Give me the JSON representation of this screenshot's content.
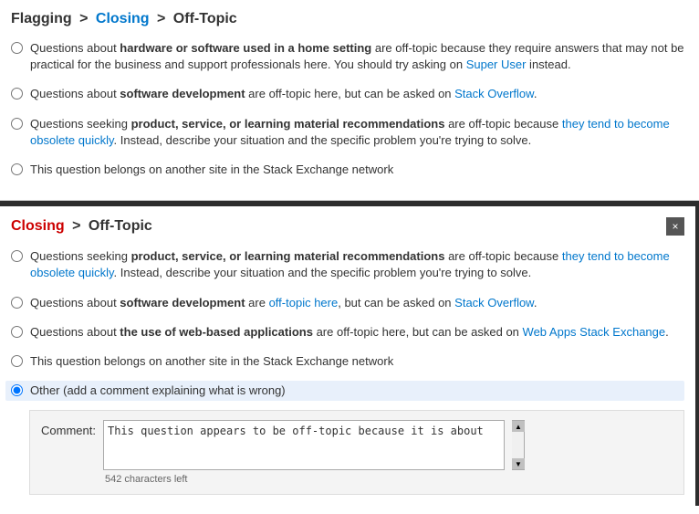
{
  "top": {
    "breadcrumb": {
      "flagging": "Flagging",
      "sep1": " > ",
      "closing": "Closing",
      "sep2": " > ",
      "offtopic": "Off-Topic"
    },
    "options": [
      {
        "id": "top-opt-1",
        "html": "Questions about <strong>hardware or software used in a home setting</strong> are off-topic because they require answers that may not be practical for the business and support professionals here. You should try asking on <a href='#'>Super User</a> instead."
      },
      {
        "id": "top-opt-2",
        "html": "Questions about <strong>software development</strong> are off-topic here, but can be asked on <a href='#'>Stack Overflow</a>."
      },
      {
        "id": "top-opt-3",
        "html": "Questions seeking <strong>product, service, or learning material recommendations</strong> are off-topic because <a href='#'>they tend to become obsolete quickly</a>. Instead, describe your situation and the specific problem you're trying to solve."
      },
      {
        "id": "top-opt-4",
        "html": "This question belongs on another site in the Stack Exchange network"
      }
    ]
  },
  "bottom": {
    "breadcrumb": {
      "closing": "Closing",
      "sep": " > ",
      "offtopic": "Off-Topic"
    },
    "close_btn_label": "×",
    "options": [
      {
        "id": "bot-opt-1",
        "html": "Questions seeking <strong>product, service, or learning material recommendations</strong> are off-topic because <a href='#'>they tend to become obsolete quickly</a>. Instead, describe your situation and the specific problem you're trying to solve."
      },
      {
        "id": "bot-opt-2",
        "html": "Questions about <strong>software development</strong> are <a href='#'>off-topic here</a>, but can be asked on <a href='#'>Stack Overflow</a>."
      },
      {
        "id": "bot-opt-3",
        "html": "Questions about <strong>the use of web-based applications</strong> are off-topic here, but can be asked on <a href='#'>Web Apps Stack Exchange</a>."
      },
      {
        "id": "bot-opt-4",
        "html": "This question belongs on another site in the Stack Exchange network"
      },
      {
        "id": "bot-opt-5",
        "html": "Other (add a comment explaining what is wrong)",
        "selected": true
      }
    ],
    "comment": {
      "label": "Comment:",
      "value": "This question appears to be off-topic because it is about",
      "chars_left": "542 characters left"
    }
  }
}
